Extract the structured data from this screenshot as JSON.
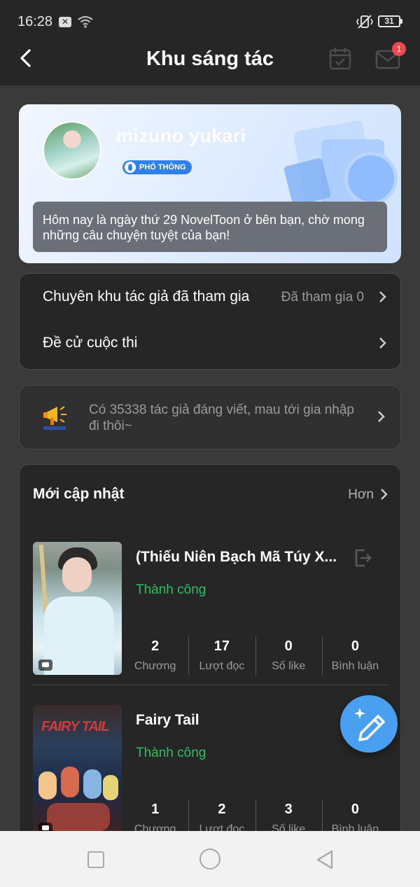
{
  "status_bar": {
    "time": "16:28",
    "battery": "31"
  },
  "header": {
    "title": "Khu sáng tác",
    "mail_badge": "1"
  },
  "profile": {
    "name": "mizuno yukari",
    "tier": "PHỔ THÔNG",
    "message": "Hôm nay là ngày thứ 29 NovelToon ở bên bạn, chờ mong những câu chuyện tuyệt của bạn!"
  },
  "menu": {
    "items": [
      {
        "label": "Chuyên khu tác giả đã tham gia",
        "value": "Đã tham gia 0"
      },
      {
        "label": "Đề cử cuộc thi",
        "value": ""
      }
    ]
  },
  "notice": {
    "text": "Có 35338 tác giả đáng viết, mau tới gia nhập đi thôi~"
  },
  "updates": {
    "title": "Mới cập nhật",
    "more": "Hơn",
    "books": [
      {
        "title": "(Thiếu Niên Bạch Mã Túy X...",
        "status": "Thành công",
        "stats": [
          {
            "value": "2",
            "label": "Chương"
          },
          {
            "value": "17",
            "label": "Lượt đọc"
          },
          {
            "value": "0",
            "label": "Số like"
          },
          {
            "value": "0",
            "label": "Bình luận"
          }
        ]
      },
      {
        "title": "Fairy Tail",
        "status": "Thành công",
        "cover_text": "FAIRY TAIL",
        "stats": [
          {
            "value": "1",
            "label": "Chương"
          },
          {
            "value": "2",
            "label": "Lượt đọc"
          },
          {
            "value": "3",
            "label": "Số like"
          },
          {
            "value": "0",
            "label": "Bình luận"
          }
        ]
      }
    ]
  },
  "colors": {
    "success": "#28c060",
    "accent": "#4aa0f0",
    "badge": "#f0484e",
    "background": "#3a3a3a"
  }
}
